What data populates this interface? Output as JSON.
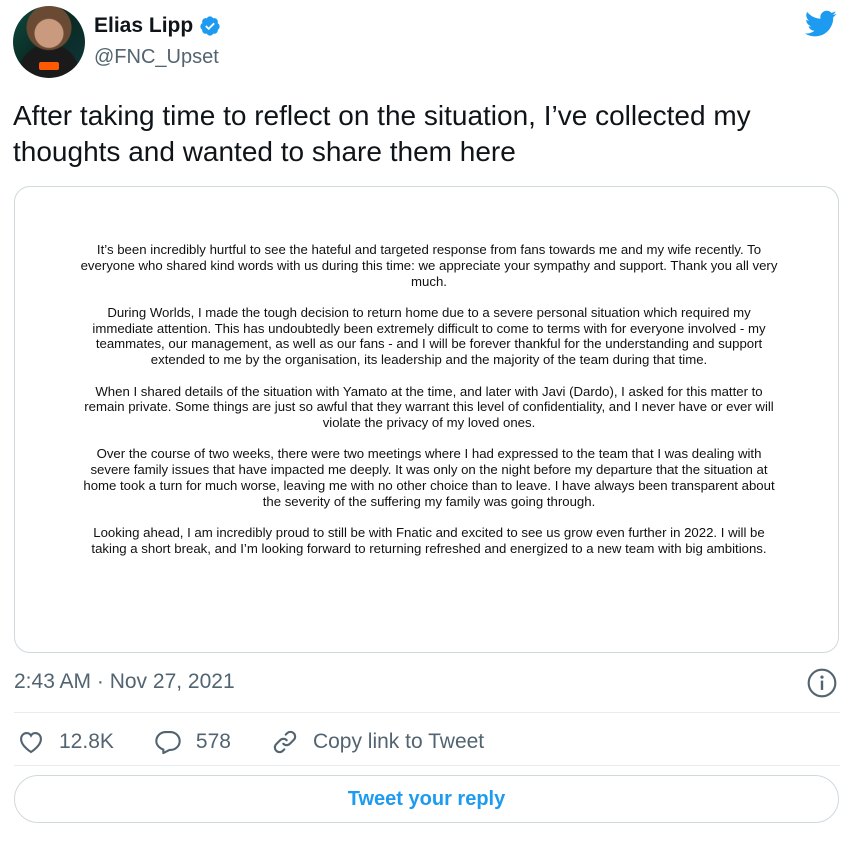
{
  "author": {
    "name": "Elias Lipp",
    "handle": "@FNC_Upset",
    "verified_icon": "verified-badge-icon",
    "avatar_icon": "avatar-image"
  },
  "tweet": {
    "text": "After taking time to reflect on the situation, I’ve collected my thoughts and wanted to share them here",
    "letter_paragraphs": [
      "It’s been incredibly hurtful to see the hateful and targeted response from fans towards me and my wife recently. To everyone who shared kind words with us during this time: we appreciate your sympathy and support. Thank you all very much.",
      "During Worlds, I made the tough decision to return home due to a severe personal situation which required my immediate attention. This has undoubtedly been extremely difficult to come to terms with for everyone involved - my teammates, our management, as well as our fans - and I will be forever thankful for the understanding and support extended to me by the organisation, its leadership and the majority of the team during that time.",
      "When I shared details of the situation with Yamato at the time, and later with Javi (Dardo), I asked for this matter to remain private. Some things are just so awful that they warrant this level of confidentiality, and I never have or ever will violate the privacy of my loved ones.",
      "Over the course of two weeks, there were two meetings where I had expressed to the team that I was dealing with severe family issues that have impacted me deeply. It was only on the night before my departure that the situation at home took a turn for much worse, leaving me with no other choice than to leave. I have always been transparent about the severity of the suffering my family was going through.",
      "Looking ahead, I am incredibly proud to still be with Fnatic and excited to see us grow even further in 2022. I will be taking a short break, and I’m looking forward to returning refreshed and energized to a new team with big ambitions."
    ],
    "timestamp": "2:43 AM · Nov 27, 2021"
  },
  "actions": {
    "likes": "12.8K",
    "replies": "578",
    "copy_link": "Copy link to Tweet"
  },
  "reply_button": "Tweet your reply",
  "colors": {
    "accent": "#1d9bf0",
    "secondary_text": "#536471",
    "border": "#cfd9de"
  }
}
